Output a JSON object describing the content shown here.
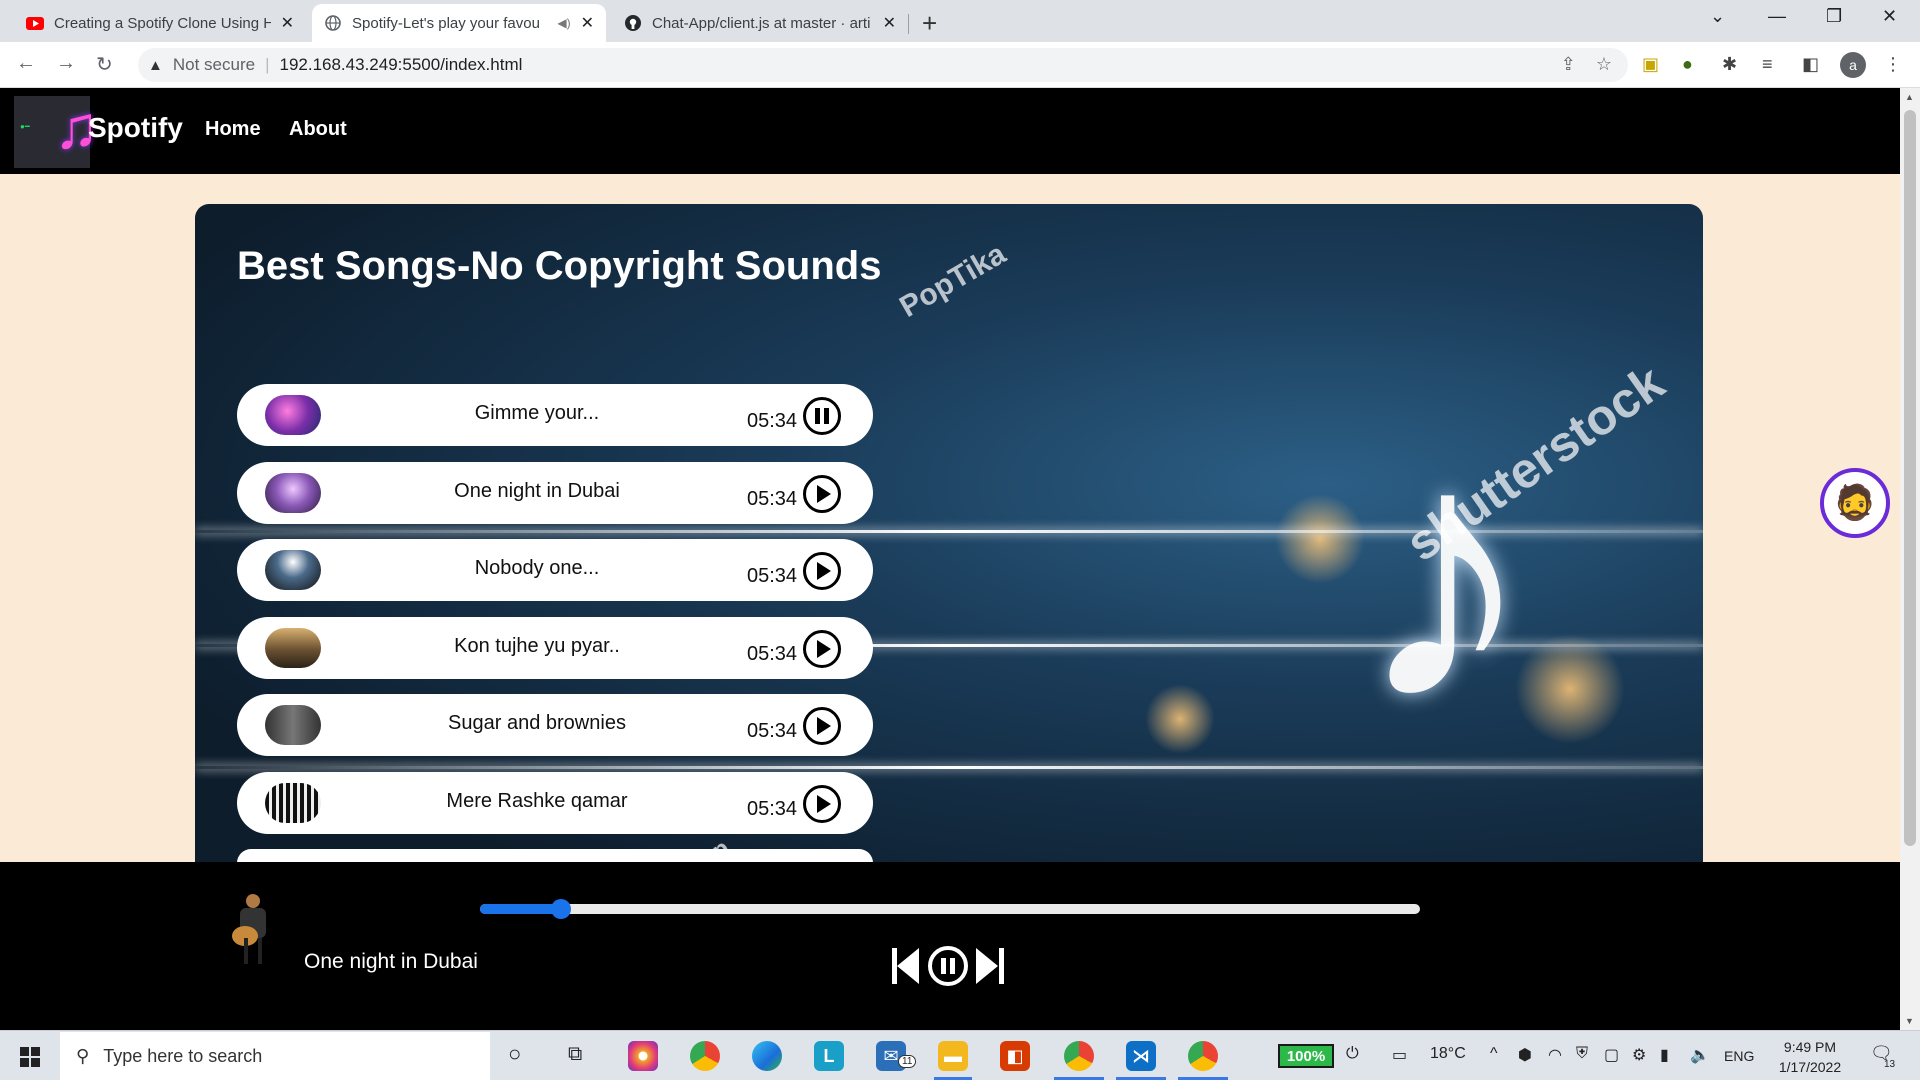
{
  "browser": {
    "tabs": [
      {
        "title": "Creating a Spotify Clone Using H",
        "favicon": "youtube-icon",
        "active": false
      },
      {
        "title": "Spotify-Let's play your favou",
        "favicon": "globe-icon",
        "active": true,
        "muted": true
      },
      {
        "title": "Chat-App/client.js at master · arti",
        "favicon": "github-icon",
        "active": false
      }
    ],
    "address": {
      "security_label": "Not secure",
      "url": "192.168.43.249:5500/index.html"
    },
    "profile_initial": "a"
  },
  "site": {
    "brand": "Spotify",
    "nav": {
      "home": "Home",
      "about": "About"
    },
    "hero_title": "Best Songs-No Copyright Sounds",
    "watermarks": {
      "poptika": "PopTika",
      "shutterstock": "shutterstock",
      "pop_partial": "Pop"
    },
    "songs": [
      {
        "name": "Gimme your...",
        "duration": "05:34",
        "state": "playing",
        "cover_color": "#8e44ad"
      },
      {
        "name": "One night in Dubai",
        "duration": "05:34",
        "state": "paused",
        "cover_color": "#6b4aa0"
      },
      {
        "name": "Nobody one...",
        "duration": "05:34",
        "state": "paused",
        "cover_color": "#2c3e50"
      },
      {
        "name": "Kon tujhe yu pyar..",
        "duration": "05:34",
        "state": "paused",
        "cover_color": "#7a6a4a"
      },
      {
        "name": "Sugar and brownies",
        "duration": "05:34",
        "state": "paused",
        "cover_color": "#555555"
      },
      {
        "name": "Mere Rashke qamar",
        "duration": "05:34",
        "state": "paused",
        "cover_color": "#1c1c1c"
      }
    ]
  },
  "player": {
    "current_song": "One night in Dubai",
    "progress_fraction": 0.086,
    "accent": "#1a73e8"
  },
  "taskbar": {
    "search_placeholder": "Type here to search",
    "battery": "100%",
    "temperature": "18°C",
    "language": "ENG",
    "time": "9:49 PM",
    "date": "1/17/2022",
    "mail_badge": "11",
    "notification_count": "13"
  }
}
